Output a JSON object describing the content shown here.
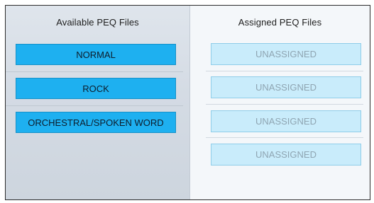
{
  "left_panel": {
    "header": "Available PEQ Files",
    "files": [
      {
        "label": "NORMAL"
      },
      {
        "label": "ROCK"
      },
      {
        "label": "ORCHESTRAL/SPOKEN WORD"
      }
    ]
  },
  "right_panel": {
    "header": "Assigned PEQ Files",
    "slots": [
      {
        "label": "UNASSIGNED"
      },
      {
        "label": "UNASSIGNED"
      },
      {
        "label": "UNASSIGNED"
      },
      {
        "label": "UNASSIGNED"
      }
    ]
  },
  "colors": {
    "file_button_bg": "#1eb0f0",
    "slot_bg": "#c9ecfb",
    "slot_text": "#8fa5b2"
  }
}
